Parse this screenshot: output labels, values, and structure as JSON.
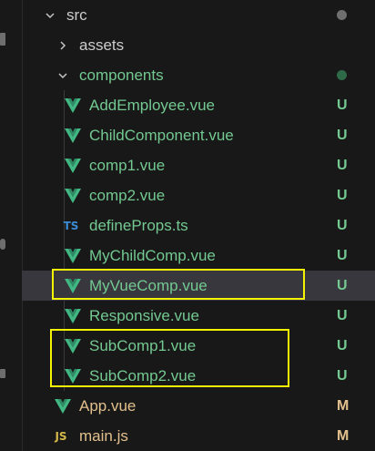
{
  "explorer": {
    "src": {
      "label": "src"
    },
    "assets": {
      "label": "assets"
    },
    "components": {
      "label": "components"
    },
    "files": [
      {
        "name": "AddEmployee.vue",
        "icon": "vue-icon",
        "status": "U"
      },
      {
        "name": "ChildComponent.vue",
        "icon": "vue-icon",
        "status": "U"
      },
      {
        "name": "comp1.vue",
        "icon": "vue-icon",
        "status": "U"
      },
      {
        "name": "comp2.vue",
        "icon": "vue-icon",
        "status": "U"
      },
      {
        "name": "defineProps.ts",
        "icon": "ts-icon",
        "icon_text": "TS",
        "status": "U"
      },
      {
        "name": "MyChildComp.vue",
        "icon": "vue-icon",
        "status": "U"
      },
      {
        "name": "MyVueComp.vue",
        "icon": "vue-icon",
        "status": "U"
      },
      {
        "name": "Responsive.vue",
        "icon": "vue-icon",
        "status": "U"
      },
      {
        "name": "SubComp1.vue",
        "icon": "vue-icon",
        "status": "U"
      },
      {
        "name": "SubComp2.vue",
        "icon": "vue-icon",
        "status": "U"
      }
    ],
    "root_files": [
      {
        "name": "App.vue",
        "icon": "vue-icon",
        "status": "M"
      },
      {
        "name": "main.js",
        "icon": "js-icon",
        "icon_text": "JS",
        "status": "M"
      }
    ]
  },
  "colors": {
    "untracked": "#73c991",
    "modified": "#e2c08d",
    "folder_text": "#cccccc",
    "vue_green": "#41b883",
    "highlight_box": "#f4f400",
    "selected_row": "#37373d"
  }
}
